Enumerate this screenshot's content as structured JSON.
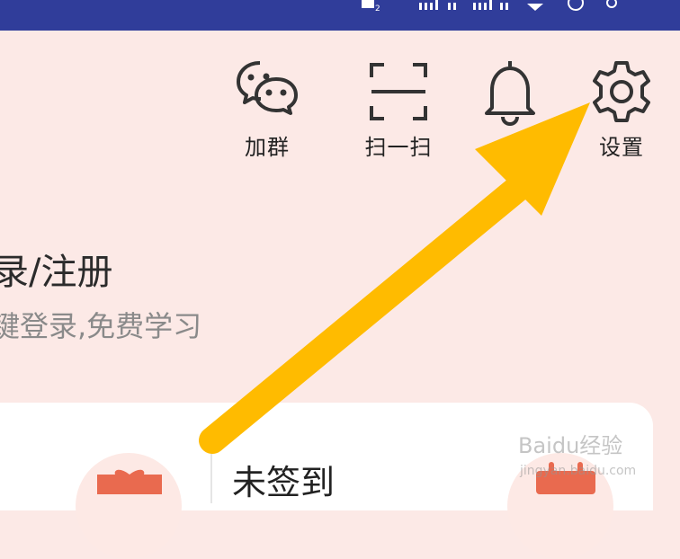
{
  "toolbar": {
    "items": [
      {
        "label": "加群",
        "icon": "wechat-icon"
      },
      {
        "label": "扫一扫",
        "icon": "scan-icon"
      },
      {
        "label": "",
        "icon": "bell-icon"
      },
      {
        "label": "设置",
        "icon": "gear-icon"
      }
    ]
  },
  "login": {
    "title": "录/注册",
    "subtitle": "键登录,免费学习"
  },
  "checkin": {
    "status": "未签到"
  },
  "watermark": {
    "text": "Baidu经验",
    "url": "jingyan.baidu.com"
  },
  "colors": {
    "statusbar": "#303D9A",
    "background": "#FCE9E6",
    "arrow": "#FFBB00",
    "accent": "#E96A4F"
  }
}
